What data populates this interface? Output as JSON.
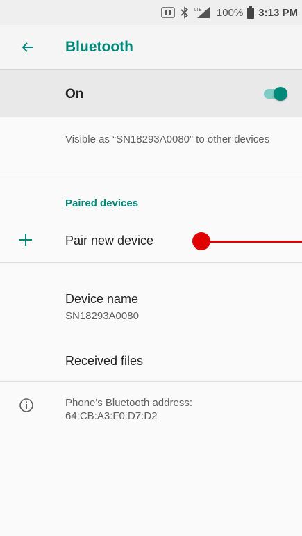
{
  "status_bar": {
    "battery": "100%",
    "time": "3:13 PM",
    "icons": [
      "nfc-icon",
      "bluetooth-icon",
      "lte-signal-icon",
      "battery-icon"
    ]
  },
  "app_bar": {
    "title": "Bluetooth",
    "back_icon": "arrow-back-icon"
  },
  "toggle_row": {
    "label": "On",
    "state": true
  },
  "visibility_text": "Visible as “SN18293A0080” to other devices",
  "paired_section": {
    "header": "Paired devices"
  },
  "pair_new": {
    "label": "Pair new device",
    "icon": "plus-icon"
  },
  "device_name": {
    "title": "Device name",
    "value": "SN18293A0080"
  },
  "received_files": {
    "label": "Received files"
  },
  "bt_address": {
    "line1": "Phone's Bluetooth address:",
    "line2": "64:CB:A3:F0:D7:D2",
    "icon": "info-icon"
  },
  "colors": {
    "accent": "#00897b",
    "toggle_track": "#80cbc4",
    "marker": "#e00000"
  }
}
